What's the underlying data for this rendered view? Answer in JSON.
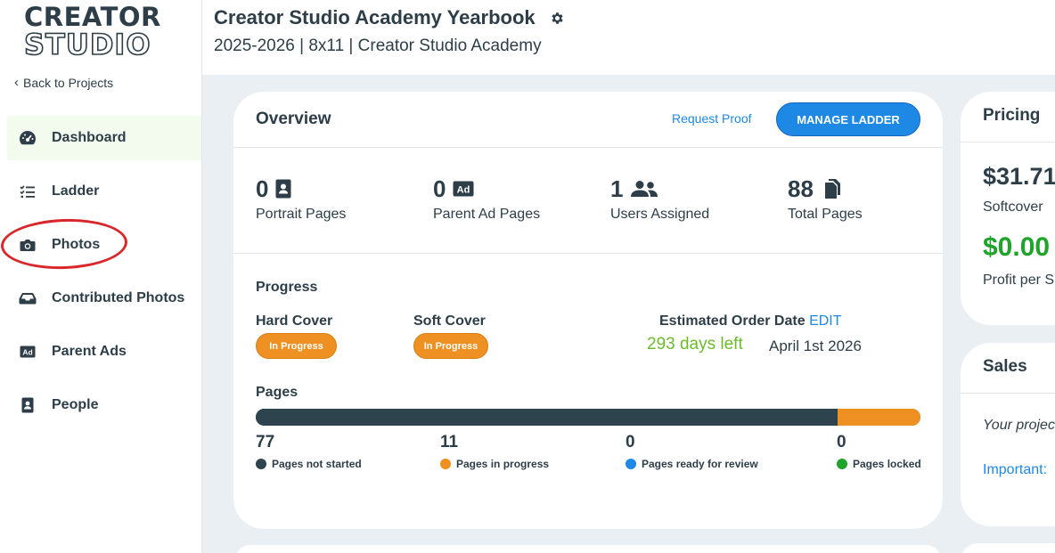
{
  "brand": {
    "line1": "CREATOR",
    "line2": "STUDIO"
  },
  "sidebar": {
    "back_label": "Back to Projects",
    "items": [
      {
        "label": "Dashboard",
        "icon": "gauge-icon",
        "active": true
      },
      {
        "label": "Ladder",
        "icon": "checklist-icon"
      },
      {
        "label": "Photos",
        "icon": "camera-icon"
      },
      {
        "label": "Contributed Photos",
        "icon": "inbox-tray-icon"
      },
      {
        "label": "Parent Ads",
        "icon": "ad-icon"
      },
      {
        "label": "People",
        "icon": "person-badge-icon"
      }
    ]
  },
  "header": {
    "title": "Creator Studio Academy Yearbook",
    "subtitle": "2025-2026 | 8x11 | Creator Studio Academy"
  },
  "overview": {
    "title": "Overview",
    "request_proof": "Request Proof",
    "manage_ladder": "MANAGE LADDER",
    "stats": [
      {
        "value": "0",
        "label": "Portrait Pages",
        "icon": "portrait-icon"
      },
      {
        "value": "0",
        "label": "Parent Ad Pages",
        "icon": "ad-icon"
      },
      {
        "value": "1",
        "label": "Users Assigned",
        "icon": "users-icon"
      },
      {
        "value": "88",
        "label": "Total Pages",
        "icon": "copy-pages-icon"
      }
    ],
    "progress_label": "Progress",
    "hard_cover": {
      "label": "Hard Cover",
      "status": "In Progress"
    },
    "soft_cover": {
      "label": "Soft Cover",
      "status": "In Progress"
    },
    "estimated_order": {
      "label": "Estimated Order Date",
      "edit": "EDIT",
      "days_left": "293 days left",
      "date": "April 1st 2026"
    },
    "pages_label": "Pages",
    "pages": [
      {
        "count": "77",
        "label": "Pages not started",
        "color": "#2d444f",
        "value": 77
      },
      {
        "count": "11",
        "label": "Pages in progress",
        "color": "#ee9122",
        "value": 11
      },
      {
        "count": "0",
        "label": "Pages ready for review",
        "color": "#1e88e5",
        "value": 0
      },
      {
        "count": "0",
        "label": "Pages locked",
        "color": "#1fa32a",
        "value": 0
      }
    ]
  },
  "pricing": {
    "title": "Pricing",
    "price": "$31.71",
    "price_label": "Softcover",
    "profit": "$0.00",
    "profit_label": "Profit per S"
  },
  "sales": {
    "title": "Sales",
    "text": "Your projec",
    "important": "Important:"
  },
  "colors": {
    "accent": "#1e88e5",
    "orange": "#ee9122",
    "green": "#6cbb2c",
    "dark": "#2d3e48",
    "profit": "#1fa32a"
  }
}
